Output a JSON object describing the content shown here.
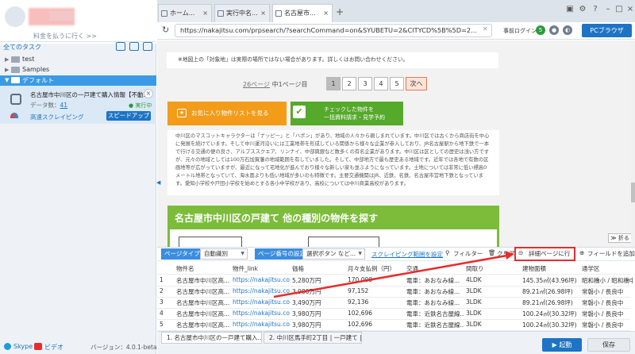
{
  "sidebar": {
    "upgrade_text": "料金を払うに行く >>",
    "all_tasks": "全てのタスク",
    "tree": [
      {
        "label": "test",
        "expanded": false
      },
      {
        "label": "Samples",
        "expanded": false
      },
      {
        "label": "デフォルト",
        "expanded": true
      }
    ],
    "task": {
      "title": "名古屋市中川区の一戸建て購入情報【不動…",
      "data_label": "データ数：",
      "data_count": "41",
      "status": "● 実行中",
      "speed_text": "高速スクレイピング",
      "speedup_label": "スピードアップ"
    },
    "footer": {
      "skype": "Skype",
      "video": "ビデオ",
      "version": "バージョン：4.0.1-beta.6"
    }
  },
  "browser": {
    "tabs": [
      {
        "label": "ホーム..."
      },
      {
        "label": "実行中名..."
      },
      {
        "label": "名古屋市..."
      }
    ],
    "new_tab": "+",
    "url": "https://nakajitsu.com/prpsearch/?searchCommand=on&SYUBETU=2&CITYCD%5B%5D=2...",
    "jizen_login": "事前ログイン",
    "pc_browser": "PCブラウザ"
  },
  "page": {
    "notice": "※地図上の「対象地」は実際の場所ではない場合があります。詳しくはお問い合わせください。",
    "pagination_text": "中1ページ目",
    "pagination_link": "26ページ",
    "pages": [
      "1",
      "2",
      "3",
      "4",
      "5"
    ],
    "next": "次へ",
    "fav_button": "お気に入り物件リストを見る",
    "request_button_line1": "チェックした物件を",
    "request_button_line2": "一括資料請求・見学予約",
    "description": "中川区のマスコットキャラクターは「ナッピー」と「ハポン」があり、地域の人々から親しまれています。中川区では古くから商店街を中心に発展を続けています。そして中川運河沿いには工業地帯を形成している関係から様々な企業が参入しており、JR名古屋駅から地下鉄で一本で行ける交通の便の良さ、アルプススクエア、リンナイ、中部興銀など数多くの有名企業があります。中川区は区としての歴史は浅い方ですが、元々の地域としては100万石加賀藩の地域範囲を有していました。そして、中部地方で最も歴史ある地域です。近年では各地で有数の区画地等が広がっていますが、最近になって宅地化が進んでおり様々な新しい家も並ぶようになっています。土地については非常に低い標高0メートル地帯となっていて、海水面よりも低い地域が多いのも特徴です。主要交通機関はJR、近鉄、名鉄、名古屋市営地下鉄となっています。愛知小学校や戸田小学校を始めとする各小中学校があり、高校については中川商業高校があります。",
    "section_title": "名古屋市中川区の戸建て 他の種別の物件を探す",
    "collapse": "折る"
  },
  "toolbar": {
    "page_type_label": "ページタイプ",
    "page_type_value": "自動識別",
    "page_number_label": "ページ番号の設定",
    "page_number_value": "選択ボタン など...",
    "scrape_scope": "スクレイピング範囲を設定",
    "filter": "フィルター",
    "clear": "クリア",
    "detail": "詳細ページに行く",
    "add_field": "フィールドを追加"
  },
  "table": {
    "columns": [
      "物件名",
      "物件_link",
      "価格",
      "月々支払例（円）",
      "交通",
      "間取り",
      "建物面積",
      "通学区"
    ],
    "rows": [
      [
        "1",
        "名古屋市中川区高...",
        "https://nakajitsu.com",
        "5,280万円",
        "170,000",
        "電車：あおなみ線...",
        "4LDK",
        "145.35㎡(43.96坪)",
        "昭和橋小 / 昭和橋中"
      ],
      [
        "2",
        "名古屋市中川区高...",
        "https://nakajitsu.co...",
        "3,980万円",
        "97,152",
        "電車：あおなみ線...",
        "3LDK",
        "89.21㎡(26.98坪)",
        "常磐小 / 長良中"
      ],
      [
        "3",
        "名古屋市中川区高...",
        "https://nakajitsu.co...",
        "3,490万円",
        "92,136",
        "電車：あおなみ線...",
        "3LDK",
        "89.21㎡(26.98坪)",
        "常磐小 / 長良中"
      ],
      [
        "4",
        "名古屋市中川区高...",
        "https://nakajitsu.co...",
        "3,980万円",
        "102,696",
        "電車：近鉄名古屋線...",
        "3LDK",
        "100.24㎡(30.32坪)",
        "常磐小 / 長良中"
      ],
      [
        "5",
        "名古屋市中川区高...",
        "https://nakajitsu.co...",
        "3,980万円",
        "102,696",
        "電車：近鉄名古屋線...",
        "3LDK",
        "100.24㎡(30.32坪)",
        "常磐小 / 長良中"
      ]
    ]
  },
  "bottom": {
    "tabs": [
      "1. 名古屋市中川区の一戸建て購入...",
      "2. 中川区馬手町2丁目 | 一戸建て | ..."
    ],
    "start": "▶ 起動",
    "save": "保存"
  },
  "colors": {
    "accent": "#1d74c4",
    "highlight_red": "#e52d2d",
    "fav_orange": "#f29c1a",
    "request_green": "#55a92b"
  }
}
